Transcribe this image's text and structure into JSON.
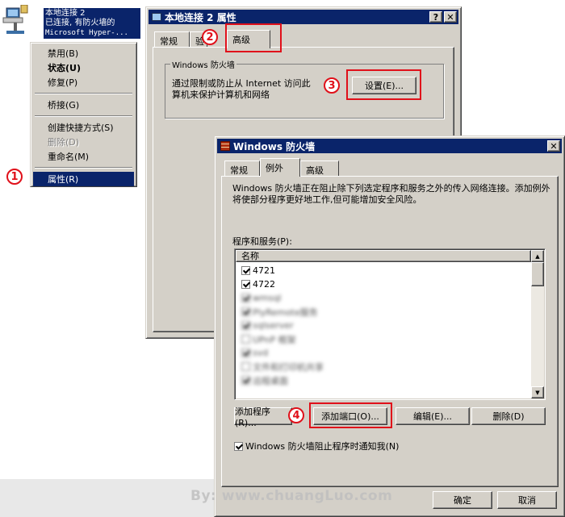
{
  "network_icon": {
    "line1": "本地连接 2",
    "line2": "已连接, 有防火墙的",
    "line3": "Microsoft Hyper-..."
  },
  "context_menu": {
    "items": [
      "禁用(B)",
      "状态(U)",
      "修复(P)",
      "桥接(G)",
      "创建快捷方式(S)",
      "删除(D)",
      "重命名(M)",
      "属性(R)"
    ]
  },
  "props_window": {
    "title": "本地连接 2 属性",
    "tabs": [
      "常规",
      "验",
      "高级"
    ],
    "group_label": "Windows 防火墙",
    "desc1": "通过限制或防止从 Internet 访问此",
    "desc2": "算机来保护计算机和网络",
    "settings_button": "设置(E)..."
  },
  "firewall_window": {
    "title": "Windows 防火墙",
    "tabs": [
      "常规",
      "例外",
      "高级"
    ],
    "desc": "Windows 防火墙正在阻止除下列选定程序和服务之外的传入网络连接。添加例外将使部分程序更好地工作,但可能增加安全风险。",
    "list_label": "程序和服务(P):",
    "list_header": "名称",
    "list_items": [
      {
        "label": "4721",
        "checked": true
      },
      {
        "label": "4722",
        "checked": true
      },
      {
        "label": "wmsql",
        "checked": true
      },
      {
        "label": "PlyRemote服务",
        "checked": true
      },
      {
        "label": "sqlserver",
        "checked": true
      },
      {
        "label": "UPnP 框架",
        "checked": false
      },
      {
        "label": "svd",
        "checked": true
      },
      {
        "label": "文件和打印机共享",
        "checked": false
      },
      {
        "label": "远程桌面",
        "checked": true
      }
    ],
    "add_program_button": "添加程序(R)...",
    "add_port_button": "添加端口(O)...",
    "edit_button": "编辑(E)...",
    "delete_button": "删除(D)",
    "notify_checkbox": "Windows 防火墙阻止程序时通知我(N)",
    "notify_checked": true,
    "ok_button": "确定",
    "cancel_button": "取消"
  },
  "callouts": [
    "1",
    "2",
    "3",
    "4"
  ],
  "watermark": "By: www.chuangLuo.com",
  "colors": {
    "titlebar": "#0a246a",
    "callout": "#e0101a",
    "window_face": "#d4d0c8"
  }
}
